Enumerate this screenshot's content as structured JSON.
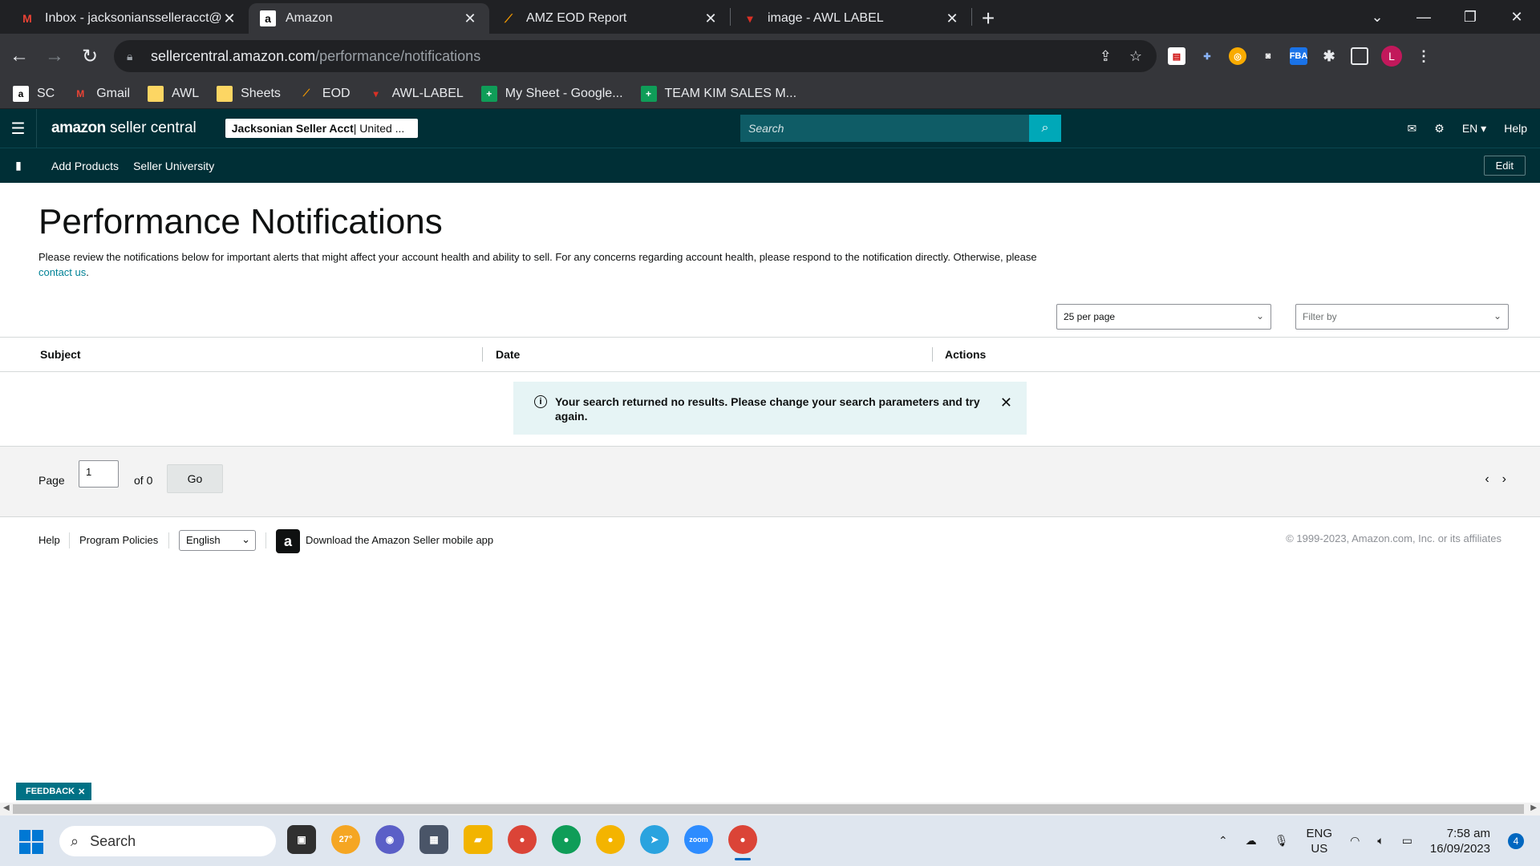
{
  "browser": {
    "tabs": [
      {
        "title": "Inbox - jacksoniansselleracct@gm",
        "icon": "gmail-icon",
        "active": false
      },
      {
        "title": "Amazon",
        "icon": "amazon-icon",
        "active": true
      },
      {
        "title": "AMZ EOD Report",
        "icon": "eod-icon",
        "active": false
      },
      {
        "title": "image - AWL LABEL",
        "icon": "awl-label-icon",
        "active": false
      }
    ],
    "url_host": "sellercentral.amazon.com",
    "url_path": "/performance/notifications",
    "profile_initial": "L",
    "bookmarks": [
      {
        "label": "SC",
        "icon": "amazon-icon"
      },
      {
        "label": "Gmail",
        "icon": "gmail-icon"
      },
      {
        "label": "AWL",
        "icon": "folder-icon"
      },
      {
        "label": "Sheets",
        "icon": "folder-icon"
      },
      {
        "label": "EOD",
        "icon": "eod-icon"
      },
      {
        "label": "AWL-LABEL",
        "icon": "awl-label-icon"
      },
      {
        "label": "My Sheet - Google...",
        "icon": "sheets-icon"
      },
      {
        "label": "TEAM KIM SALES M...",
        "icon": "sheets-icon"
      }
    ]
  },
  "seller_header": {
    "logo_main": "amazon",
    "logo_sub": "seller central",
    "account_bold": "Jacksonian Seller Acct",
    "account_rest": " | United ...",
    "search_placeholder": "Search",
    "lang": "EN",
    "help": "Help"
  },
  "subnav": {
    "links": [
      "Add Products",
      "Seller University"
    ],
    "edit": "Edit"
  },
  "page": {
    "title": "Performance Notifications",
    "desc_text": "Please review the notifications below for important alerts that might affect your account health and ability to sell. For any concerns regarding account health, please respond to the notification directly. Otherwise, please ",
    "desc_link": "contact us",
    "desc_end": ".",
    "per_page": "25 per page",
    "filter_placeholder": "Filter by"
  },
  "table": {
    "columns": [
      "Subject",
      "Date",
      "Actions"
    ],
    "alert": "Your search returned no results. Please change your search parameters and try again."
  },
  "pager": {
    "page_label": "Page",
    "page_value": "1",
    "of_label": "of 0",
    "go": "Go"
  },
  "footer": {
    "help": "Help",
    "policies": "Program Policies",
    "language": "English",
    "app": "Download the Amazon Seller mobile app",
    "copyright": "© 1999-2023, Amazon.com, Inc. or its affiliates"
  },
  "feedback": "FEEDBACK",
  "taskbar": {
    "search": "Search",
    "weather": "27°",
    "lang1": "ENG",
    "lang2": "US",
    "time": "7:58 am",
    "date": "16/09/2023",
    "notifications": "4"
  },
  "colors": {
    "header_bg": "#002f36",
    "accent": "#00a8b8",
    "link": "#008296",
    "alert_bg": "#e6f4f5"
  }
}
